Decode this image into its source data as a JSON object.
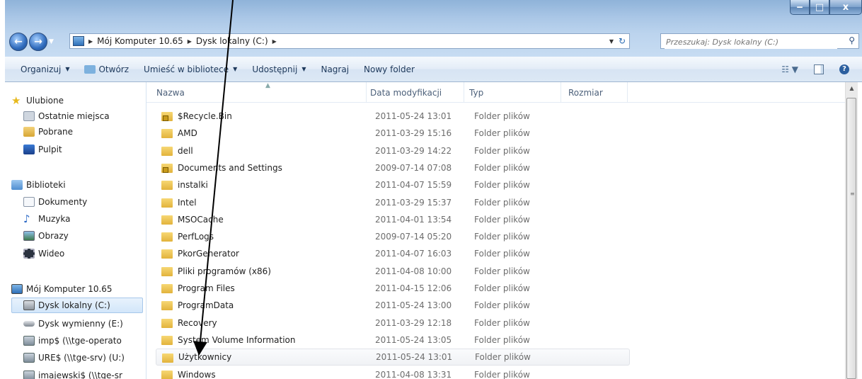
{
  "window": {
    "controls": {
      "minimize": "‒",
      "maximize": "□",
      "close": "x"
    }
  },
  "address": {
    "crumbs": [
      "Mój Komputer 10.65",
      "Dysk lokalny (C:)"
    ],
    "search_placeholder": "Przeszukaj: Dysk lokalny (C:)"
  },
  "toolbar": {
    "organize": "Organizuj",
    "open": "Otwórz",
    "library": "Umieść w bibliotece",
    "share": "Udostępnij",
    "burn": "Nagraj",
    "new_folder": "Nowy folder"
  },
  "sidebar": {
    "favorites": "Ulubione",
    "recent": "Ostatnie miejsca",
    "downloads": "Pobrane",
    "desktop": "Pulpit",
    "libraries": "Biblioteki",
    "documents": "Dokumenty",
    "music": "Muzyka",
    "pictures": "Obrazy",
    "video": "Wideo",
    "computer": "Mój Komputer 10.65",
    "drive_c": "Dysk lokalny (C:)",
    "drive_e": "Dysk wymienny (E:)",
    "share_imp": "imp$ (\\\\tge-operato",
    "share_ures": "URE$ (\\\\tge-srv) (U:)",
    "share_imajewski": "imajewski$ (\\\\tge-sr"
  },
  "columns": {
    "name": "Nazwa",
    "date": "Data modyfikacji",
    "type": "Typ",
    "size": "Rozmiar"
  },
  "files": [
    {
      "name": "$Recycle.Bin",
      "date": "2011-05-24 13:01",
      "type": "Folder plików"
    },
    {
      "name": "AMD",
      "date": "2011-03-29 15:16",
      "type": "Folder plików"
    },
    {
      "name": "dell",
      "date": "2011-03-29 14:22",
      "type": "Folder plików"
    },
    {
      "name": "Documents and Settings",
      "date": "2009-07-14 07:08",
      "type": "Folder plików"
    },
    {
      "name": "instalki",
      "date": "2011-04-07 15:59",
      "type": "Folder plików"
    },
    {
      "name": "Intel",
      "date": "2011-03-29 15:37",
      "type": "Folder plików"
    },
    {
      "name": "MSOCache",
      "date": "2011-04-01 13:54",
      "type": "Folder plików"
    },
    {
      "name": "PerfLogs",
      "date": "2009-07-14 05:20",
      "type": "Folder plików"
    },
    {
      "name": "PkorGenerator",
      "date": "2011-04-07 16:03",
      "type": "Folder plików"
    },
    {
      "name": "Pliki programów (x86)",
      "date": "2011-04-08 10:00",
      "type": "Folder plików"
    },
    {
      "name": "Program Files",
      "date": "2011-04-15 12:06",
      "type": "Folder plików"
    },
    {
      "name": "ProgramData",
      "date": "2011-05-24 13:00",
      "type": "Folder plików"
    },
    {
      "name": "Recovery",
      "date": "2011-03-29 12:18",
      "type": "Folder plików"
    },
    {
      "name": "System Volume Information",
      "date": "2011-05-24 13:05",
      "type": "Folder plików"
    },
    {
      "name": "Użytkownicy",
      "date": "2011-05-24 13:01",
      "type": "Folder plików"
    },
    {
      "name": "Windows",
      "date": "2011-04-08 13:31",
      "type": "Folder plików"
    }
  ]
}
